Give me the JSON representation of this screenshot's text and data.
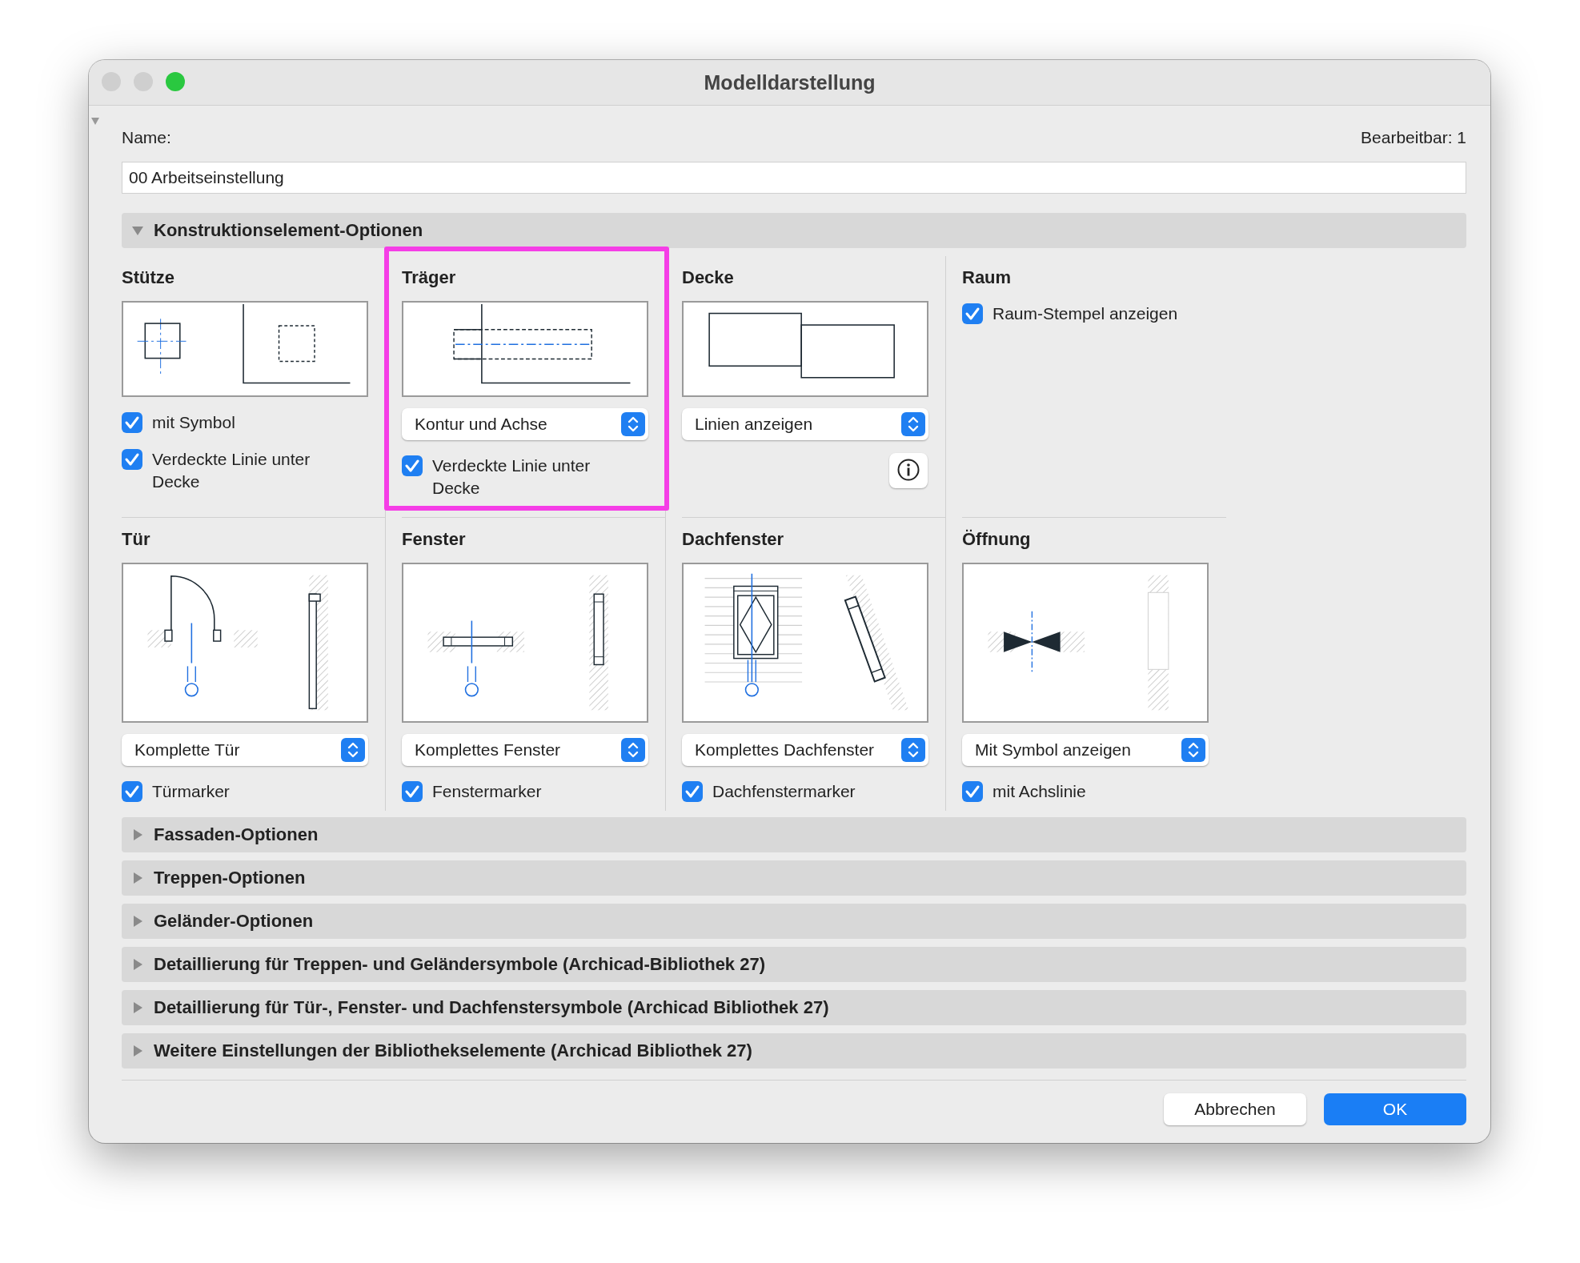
{
  "window": {
    "title": "Modelldarstellung"
  },
  "name_label": "Name:",
  "editable": "Bearbeitbar: 1",
  "name_value": "00 Arbeitseinstellung",
  "sections": [
    {
      "title": "Konstruktionselement-Optionen",
      "expanded": true,
      "groups": [
        {
          "title": "Stütze",
          "kind": "column",
          "checks": [
            {
              "label": "mit Symbol",
              "checked": true
            },
            {
              "label": "Verdeckte Linie unter Decke",
              "checked": true
            }
          ]
        },
        {
          "title": "Träger",
          "kind": "beam",
          "highlighted": true,
          "dropdown": "Kontur und Achse",
          "checks": [
            {
              "label": "Verdeckte Linie unter Decke",
              "checked": true
            }
          ]
        },
        {
          "title": "Decke",
          "kind": "slab",
          "dropdown": "Linien anzeigen",
          "info": true
        },
        {
          "title": "Raum",
          "kind": "room",
          "checks": [
            {
              "label": "Raum-Stempel anzeigen",
              "checked": true
            }
          ]
        },
        {
          "title": "Tür",
          "kind": "door",
          "dropdown": "Komplette Tür",
          "checks": [
            {
              "label": "Türmarker",
              "checked": true
            }
          ]
        },
        {
          "title": "Fenster",
          "kind": "window",
          "dropdown": "Komplettes Fenster",
          "checks": [
            {
              "label": "Fenstermarker",
              "checked": true
            }
          ]
        },
        {
          "title": "Dachfenster",
          "kind": "skylight",
          "dropdown": "Komplettes Dachfenster",
          "checks": [
            {
              "label": "Dachfenstermarker",
              "checked": true
            }
          ]
        },
        {
          "title": "Öffnung",
          "kind": "opening",
          "dropdown": "Mit Symbol anzeigen",
          "checks": [
            {
              "label": "mit Achslinie",
              "checked": true
            }
          ]
        }
      ]
    },
    {
      "title": "Fassaden-Optionen",
      "expanded": false
    },
    {
      "title": "Treppen-Optionen",
      "expanded": false
    },
    {
      "title": "Geländer-Optionen",
      "expanded": false
    },
    {
      "title": "Detaillierung für Treppen- und Geländersymbole (Archicad-Bibliothek 27)",
      "expanded": false
    },
    {
      "title": "Detaillierung für Tür-, Fenster- und Dachfenstersymbole (Archicad Bibliothek 27)",
      "expanded": false
    },
    {
      "title": "Weitere Einstellungen der Bibliothekselemente (Archicad Bibliothek 27)",
      "expanded": false
    }
  ],
  "buttons": [
    {
      "label": "Abbrechen",
      "primary": false
    },
    {
      "label": "OK",
      "primary": true
    }
  ]
}
